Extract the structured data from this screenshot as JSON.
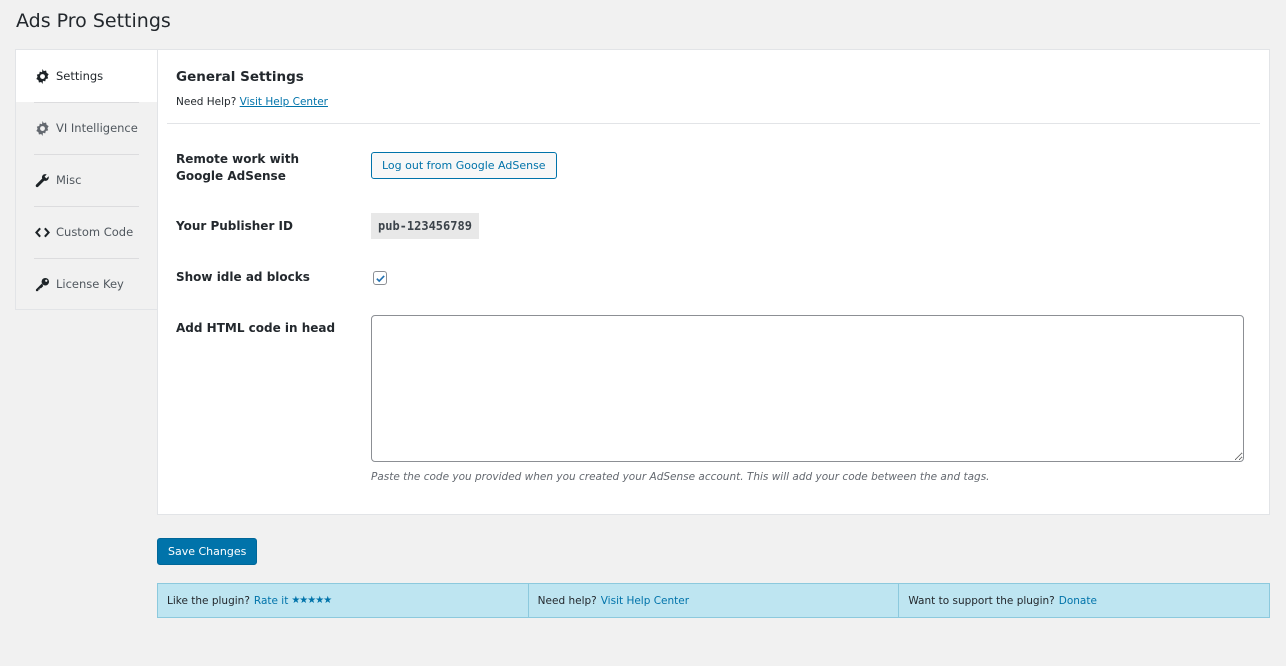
{
  "page": {
    "title": "Ads Pro Settings"
  },
  "sidebar": {
    "items": [
      {
        "label": "Settings",
        "icon": "gear-icon",
        "active": true
      },
      {
        "label": "VI Intelligence",
        "icon": "gear-icon",
        "active": false
      },
      {
        "label": "Misc",
        "icon": "wrench-icon",
        "active": false
      },
      {
        "label": "Custom Code",
        "icon": "code-icon",
        "active": false
      },
      {
        "label": "License Key",
        "icon": "key-icon",
        "active": false
      }
    ]
  },
  "main": {
    "section_title": "General Settings",
    "help_prefix": "Need Help?",
    "help_link": "Visit Help Center",
    "rows": {
      "remote_label": "Remote work with Google AdSense",
      "logout_button": "Log out from Google AdSense",
      "publisher_label": "Your Publisher ID",
      "publisher_value": "pub-123456789",
      "idle_label": "Show idle ad blocks",
      "idle_checked": true,
      "html_label": "Add HTML code in head",
      "html_value": "",
      "html_hint": "Paste the code you provided when you created your AdSense account. This will add your code between the and tags."
    }
  },
  "actions": {
    "save_label": "Save Changes"
  },
  "footer": {
    "like_text": "Like the plugin?",
    "rate_link": "Rate it",
    "stars": "★★★★★",
    "help_text": "Need help?",
    "help_link": "Visit Help Center",
    "support_text": "Want to support the plugin?",
    "donate_link": "Donate"
  },
  "colors": {
    "accent": "#0073aa",
    "footer_bg": "#bee5f1",
    "background": "#f1f1f1"
  }
}
